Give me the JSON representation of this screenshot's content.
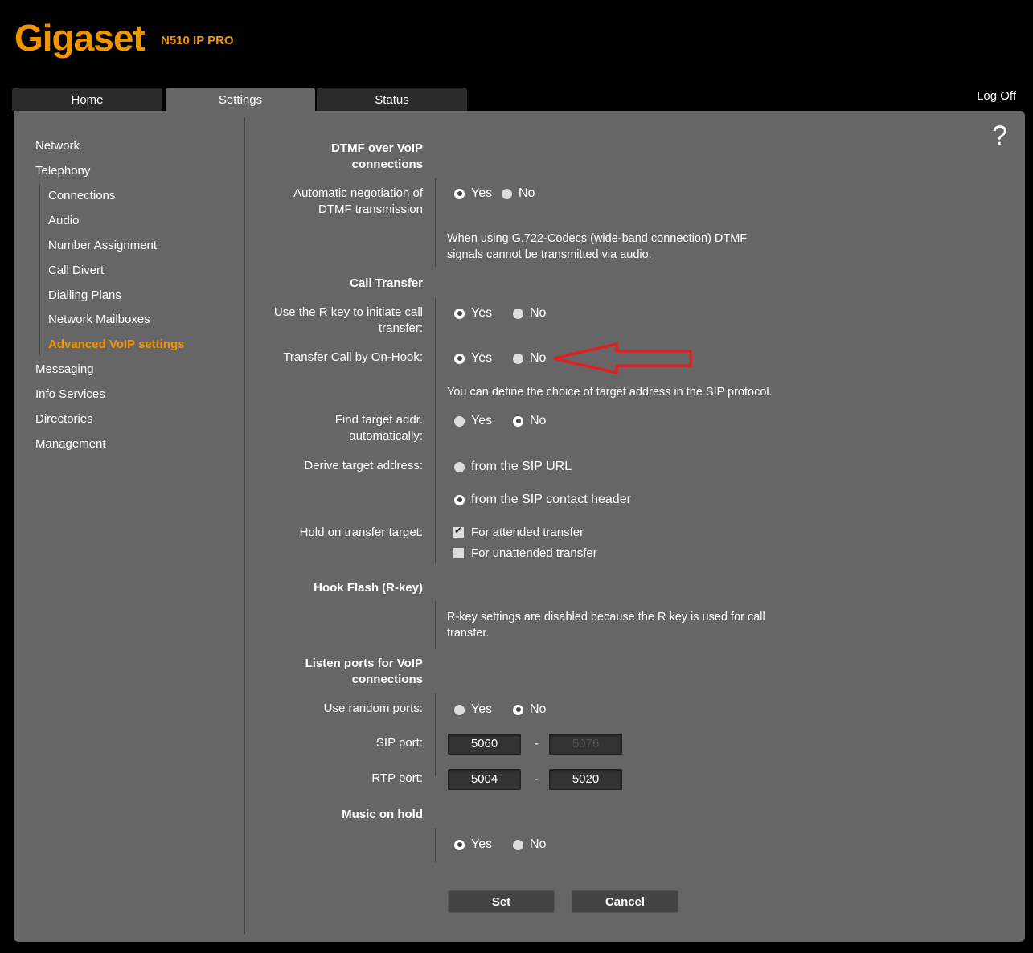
{
  "header": {
    "brand": "Gigaset",
    "model": "N510 IP PRO",
    "logoff": "Log Off"
  },
  "tabs": [
    {
      "label": "Home"
    },
    {
      "label": "Settings"
    },
    {
      "label": "Status"
    }
  ],
  "help": "?",
  "sidebar": {
    "items": [
      {
        "label": "Network"
      },
      {
        "label": "Telephony"
      },
      {
        "label": "Connections"
      },
      {
        "label": "Audio"
      },
      {
        "label": "Number Assignment"
      },
      {
        "label": "Call Divert"
      },
      {
        "label": "Dialling Plans"
      },
      {
        "label": "Network Mailboxes"
      },
      {
        "label": "Advanced VoIP settings"
      },
      {
        "label": "Messaging"
      },
      {
        "label": "Info Services"
      },
      {
        "label": "Directories"
      },
      {
        "label": "Management"
      }
    ]
  },
  "dtmf": {
    "title_l1": "DTMF over VoIP",
    "title_l2": "connections",
    "auto_label_l1": "Automatic negotiation of",
    "auto_label_l2": "DTMF transmission",
    "yes": "Yes",
    "no": "No",
    "note_l1": "When using G.722-Codecs (wide-band connection) DTMF",
    "note_l2": "signals cannot be transmitted via audio."
  },
  "transfer": {
    "title": "Call Transfer",
    "rkey_l1": "Use the R key to initiate call",
    "rkey_l2": "transfer:",
    "onhook": "Transfer Call by On-Hook:",
    "note": "You can define the choice of target address in the SIP protocol.",
    "find_l1": "Find target addr.",
    "find_l2": "automatically:",
    "derive": "Derive target address:",
    "opt_url": "from the SIP URL",
    "opt_contact": "from the SIP contact header",
    "hold": "Hold on transfer target:",
    "attended": "For attended transfer",
    "unattended": "For unattended transfer",
    "yes": "Yes",
    "no": "No"
  },
  "hookflash": {
    "title": "Hook Flash (R-key)",
    "note_l1": "R-key settings are disabled because the R key is used for call",
    "note_l2": "transfer."
  },
  "ports": {
    "title_l1": "Listen ports for VoIP",
    "title_l2": "connections",
    "random": "Use random ports:",
    "sip_label": "SIP port:",
    "sip_from": "5060",
    "sip_to": "5076",
    "rtp_label": "RTP port:",
    "rtp_from": "5004",
    "rtp_to": "5020",
    "dash": "-",
    "yes": "Yes",
    "no": "No"
  },
  "moh": {
    "title": "Music on hold",
    "yes": "Yes",
    "no": "No"
  },
  "buttons": {
    "set": "Set",
    "cancel": "Cancel"
  },
  "colors": {
    "accent": "#f29400",
    "panel": "#666666",
    "annotation_arrow": "#e02020"
  }
}
